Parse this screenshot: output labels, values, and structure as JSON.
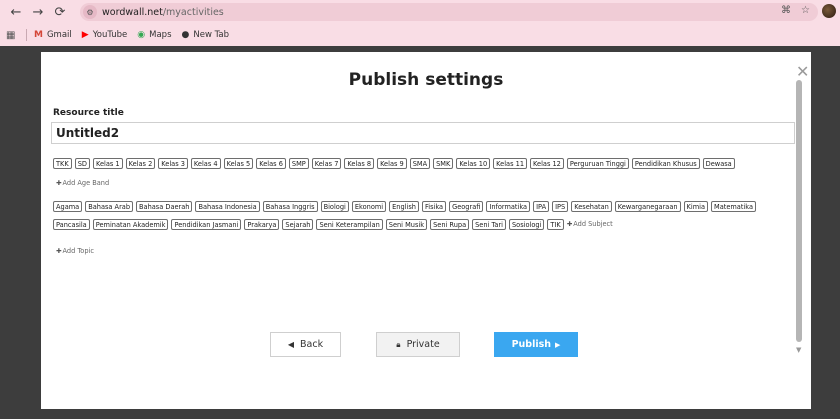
{
  "browser": {
    "url_host": "wordwall.net",
    "url_path": "/myactivities",
    "bookmarks": [
      {
        "label": "Gmail",
        "icon": "gmail-icon"
      },
      {
        "label": "YouTube",
        "icon": "youtube-icon"
      },
      {
        "label": "Maps",
        "icon": "maps-icon"
      },
      {
        "label": "New Tab",
        "icon": "chrome-icon"
      }
    ]
  },
  "modal": {
    "title": "Publish settings",
    "resource_label": "Resource title",
    "resource_value": "Untitled2",
    "age_bands": [
      "TKK",
      "SD",
      "Kelas 1",
      "Kelas 2",
      "Kelas 3",
      "Kelas 4",
      "Kelas 5",
      "Kelas 6",
      "SMP",
      "Kelas 7",
      "Kelas 8",
      "Kelas 9",
      "SMA",
      "SMK",
      "Kelas 10",
      "Kelas 11",
      "Kelas 12",
      "Perguruan Tinggi",
      "Pendidikan Khusus",
      "Dewasa"
    ],
    "add_age_band": "Add Age Band",
    "subjects": [
      "Agama",
      "Bahasa Arab",
      "Bahasa Daerah",
      "Bahasa Indonesia",
      "Bahasa Inggris",
      "Biologi",
      "Ekonomi",
      "English",
      "Fisika",
      "Geografi",
      "Informatika",
      "IPA",
      "IPS",
      "Kesehatan",
      "Kewarganegaraan",
      "Kimia",
      "Matematika",
      "Pancasila",
      "Peminatan Akademik",
      "Pendidikan Jasmani",
      "Prakarya",
      "Sejarah",
      "Seni Keterampilan",
      "Seni Musik",
      "Seni Rupa",
      "Seni Tari",
      "Sosiologi",
      "TIK"
    ],
    "add_subject": "Add Subject",
    "add_topic": "Add Topic",
    "buttons": {
      "back": "Back",
      "private": "Private",
      "publish": "Publish"
    }
  },
  "colors": {
    "browser_chrome": "#f9dde5",
    "publish_button": "#3aa7f0"
  }
}
